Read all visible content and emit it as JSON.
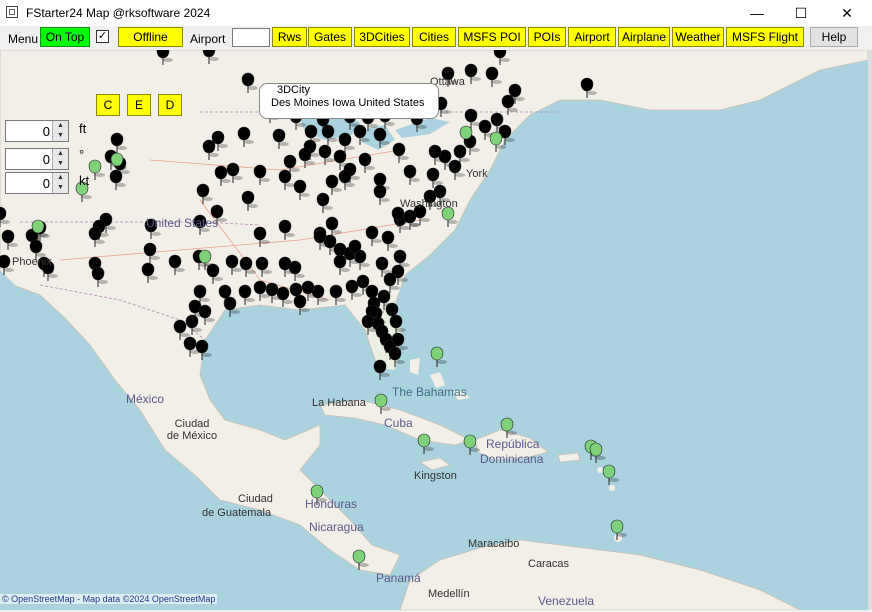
{
  "window": {
    "title": "FStarter24 Map @rksoftware 2024",
    "minimize": "—",
    "maximize": "☐",
    "close": "✕"
  },
  "toolbar": {
    "menu_label": "Menu",
    "on_top": "On Top",
    "checkbox_mark": "✓",
    "offline": "Offline",
    "airport_label": "Airport",
    "airport_value": "",
    "buttons": [
      "Rws",
      "Gates",
      "3DCities",
      "Cities",
      "MSFS POI",
      "POIs",
      "Airport",
      "Airplane",
      "Weather",
      "MSFS Flight"
    ],
    "help": "Help"
  },
  "map_controls": {
    "c": "C",
    "e": "E",
    "d": "D",
    "spinners": [
      {
        "value": "0",
        "unit": "ft"
      },
      {
        "value": "0",
        "unit": "°"
      },
      {
        "value": "0",
        "unit": "kt"
      }
    ]
  },
  "tooltip": {
    "type": "3DCity",
    "name": "Des Moines Iowa United States"
  },
  "map_labels": {
    "ottawa": "Ottawa",
    "new_york": "York",
    "washington": "Washington",
    "united_states": "United States",
    "phoenix": "Phoenix",
    "mexico": "México",
    "ciudad_mexico": "Ciudad\nde México",
    "la_habana": "La Habana",
    "cuba": "Cuba",
    "bahamas": "The Bahamas",
    "republica": "República",
    "dominicana": "Dominicana",
    "kingston": "Kingston",
    "ciudad": "Ciudad",
    "guatemala": "de Guatemala",
    "honduras": "Honduras",
    "nicaragua": "Nicaragua",
    "panama": "Panamá",
    "maracaibo": "Maracaibo",
    "caracas": "Caracas",
    "medellin": "Medellín",
    "venezuela": "Venezuela"
  },
  "attribution": "© OpenStreetMap - Map data ©2024 OpenStreetMap",
  "colors": {
    "yellow_button": "#ffff00",
    "green_button": "#00ff00",
    "water": "#aad3df",
    "land": "#f2efe9",
    "black_pin": "#000000",
    "green_pin": "#7fd17a"
  }
}
